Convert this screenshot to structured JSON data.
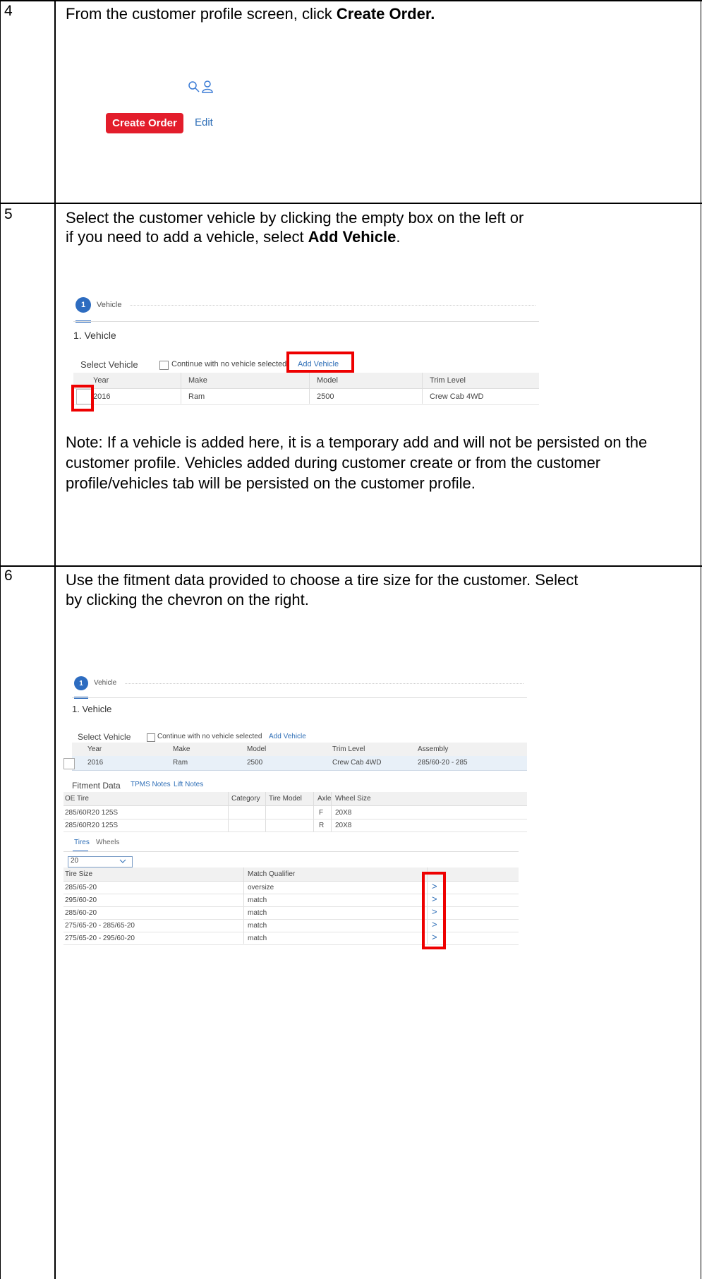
{
  "steps": [
    {
      "num": "4",
      "text_before": "From the customer profile screen, click ",
      "text_bold": "Create Order.",
      "text_after": ""
    },
    {
      "num": "5",
      "line1": "Select the customer vehicle by clicking the empty box on the left or",
      "line2_before": "if you need to add a vehicle, select ",
      "line2_bold": "Add Vehicle",
      "line2_after": "."
    },
    {
      "num": "6",
      "line1": "Use the fitment data provided to choose a tire size for the customer. Select",
      "line2": "by clicking the chevron on the right."
    }
  ],
  "step4_ui": {
    "create_order": "Create Order",
    "edit": "Edit",
    "icons": [
      "search-icon",
      "user-icon"
    ]
  },
  "step5_ui": {
    "badge": "1",
    "badge_label": "Vehicle",
    "section_title": "1. Vehicle",
    "select_vehicle": "Select Vehicle",
    "continue_label": "Continue with no vehicle selected",
    "add_vehicle": "Add Vehicle",
    "columns": [
      "Year",
      "Make",
      "Model",
      "Trim Level"
    ],
    "row": [
      "2016",
      "Ram",
      "2500",
      "Crew Cab 4WD"
    ]
  },
  "note": "Note: If a vehicle is added here, it is a temporary add and will not be persisted on the customer profile. Vehicles added during customer create or from the customer profile/vehicles tab will be persisted on the customer profile.",
  "step6_ui": {
    "badge": "1",
    "badge_label": "Vehicle",
    "section_title": "1. Vehicle",
    "select_vehicle": "Select Vehicle",
    "continue_label": "Continue with no vehicle selected",
    "add_vehicle": "Add Vehicle",
    "vehicle_columns": [
      "Year",
      "Make",
      "Model",
      "Trim Level",
      "Assembly"
    ],
    "vehicle_row": [
      "2016",
      "Ram",
      "2500",
      "Crew Cab 4WD",
      "285/60-20 - 285"
    ],
    "fitment_title": "Fitment Data",
    "tpms_notes": "TPMS Notes",
    "lift_notes": "Lift Notes",
    "fitment_columns": [
      "OE Tire",
      "Category",
      "Tire Model",
      "Axle",
      "Wheel Size"
    ],
    "fitment_rows": [
      [
        "285/60R20 125S",
        "",
        "",
        "F",
        "20X8"
      ],
      [
        "285/60R20 125S",
        "",
        "",
        "R",
        "20X8"
      ]
    ],
    "tabs": [
      "Tires",
      "Wheels"
    ],
    "select_value": "20",
    "tire_columns": [
      "Tire Size",
      "Match Qualifier"
    ],
    "tire_rows": [
      [
        "285/65-20",
        "oversize"
      ],
      [
        "295/60-20",
        "match"
      ],
      [
        "285/60-20",
        "match"
      ],
      [
        "275/65-20 - 285/65-20",
        "match"
      ],
      [
        "275/65-20 - 295/60-20",
        "match"
      ]
    ],
    "chevron": ">"
  }
}
